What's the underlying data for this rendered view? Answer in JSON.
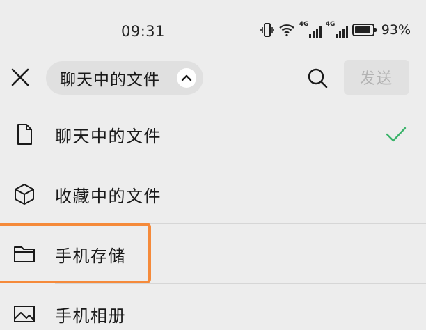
{
  "status_bar": {
    "time": "09:31",
    "network_1": "4G",
    "network_2": "4G",
    "battery": "93%",
    "battery_level": 0.93
  },
  "header": {
    "dropdown_label": "聊天中的文件",
    "send_label": "发送"
  },
  "list": {
    "items": [
      {
        "label": "聊天中的文件",
        "icon": "file-icon",
        "selected": true
      },
      {
        "label": "收藏中的文件",
        "icon": "cube-icon",
        "selected": false
      },
      {
        "label": "手机存储",
        "icon": "folder-icon",
        "selected": false
      },
      {
        "label": "手机相册",
        "icon": "image-icon",
        "selected": false
      }
    ]
  },
  "colors": {
    "check": "#3ab36a",
    "highlight": "#f58a3a",
    "background": "#ededed"
  }
}
